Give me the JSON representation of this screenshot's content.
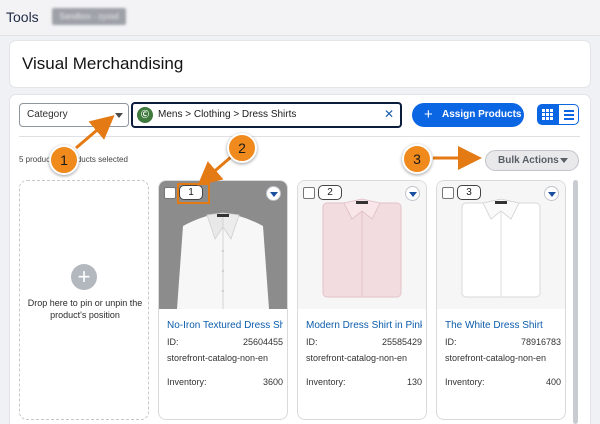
{
  "topbar": {
    "title": "Tools",
    "sandbox_label": "Sandbox - zyxsd"
  },
  "header": {
    "page_title": "Visual Merchandising"
  },
  "toolbar": {
    "category_select": "Category",
    "category_path": "Mens > Clothing > Dress Shirts",
    "assign_label": "Assign Products",
    "clear_icon": "✕",
    "plus_icon": "+"
  },
  "selection": {
    "text": "5 products 0 products selected"
  },
  "bulk_actions": {
    "label": "Bulk Actions"
  },
  "dropzone": {
    "text": "Drop here to pin or unpin the product's position"
  },
  "callouts": [
    "1",
    "2",
    "3"
  ],
  "products": [
    {
      "position": "1",
      "name": "No-Iron Textured Dress Shirt",
      "id_label": "ID:",
      "id": "25604455",
      "catalog": "storefront-catalog-non-en",
      "inventory_label": "Inventory:",
      "inventory": "3600"
    },
    {
      "position": "2",
      "name": "Modern Dress Shirt in Pink",
      "id_label": "ID:",
      "id": "25585429",
      "catalog": "storefront-catalog-non-en",
      "inventory_label": "Inventory:",
      "inventory": "130"
    },
    {
      "position": "3",
      "name": "The White Dress Shirt",
      "id_label": "ID:",
      "id": "78916783",
      "catalog": "storefront-catalog-non-en",
      "inventory_label": "Inventory:",
      "inventory": "400"
    }
  ],
  "icons": {
    "category": "category-icon",
    "clear": "close-icon",
    "plus": "plus-icon",
    "grid": "grid-view-icon",
    "list": "list-view-icon",
    "chevron": "chevron-down-icon"
  },
  "colors": {
    "brand_blue": "#0b66e4",
    "callout_orange": "#f08a1d",
    "link_blue": "#0b5cab"
  }
}
